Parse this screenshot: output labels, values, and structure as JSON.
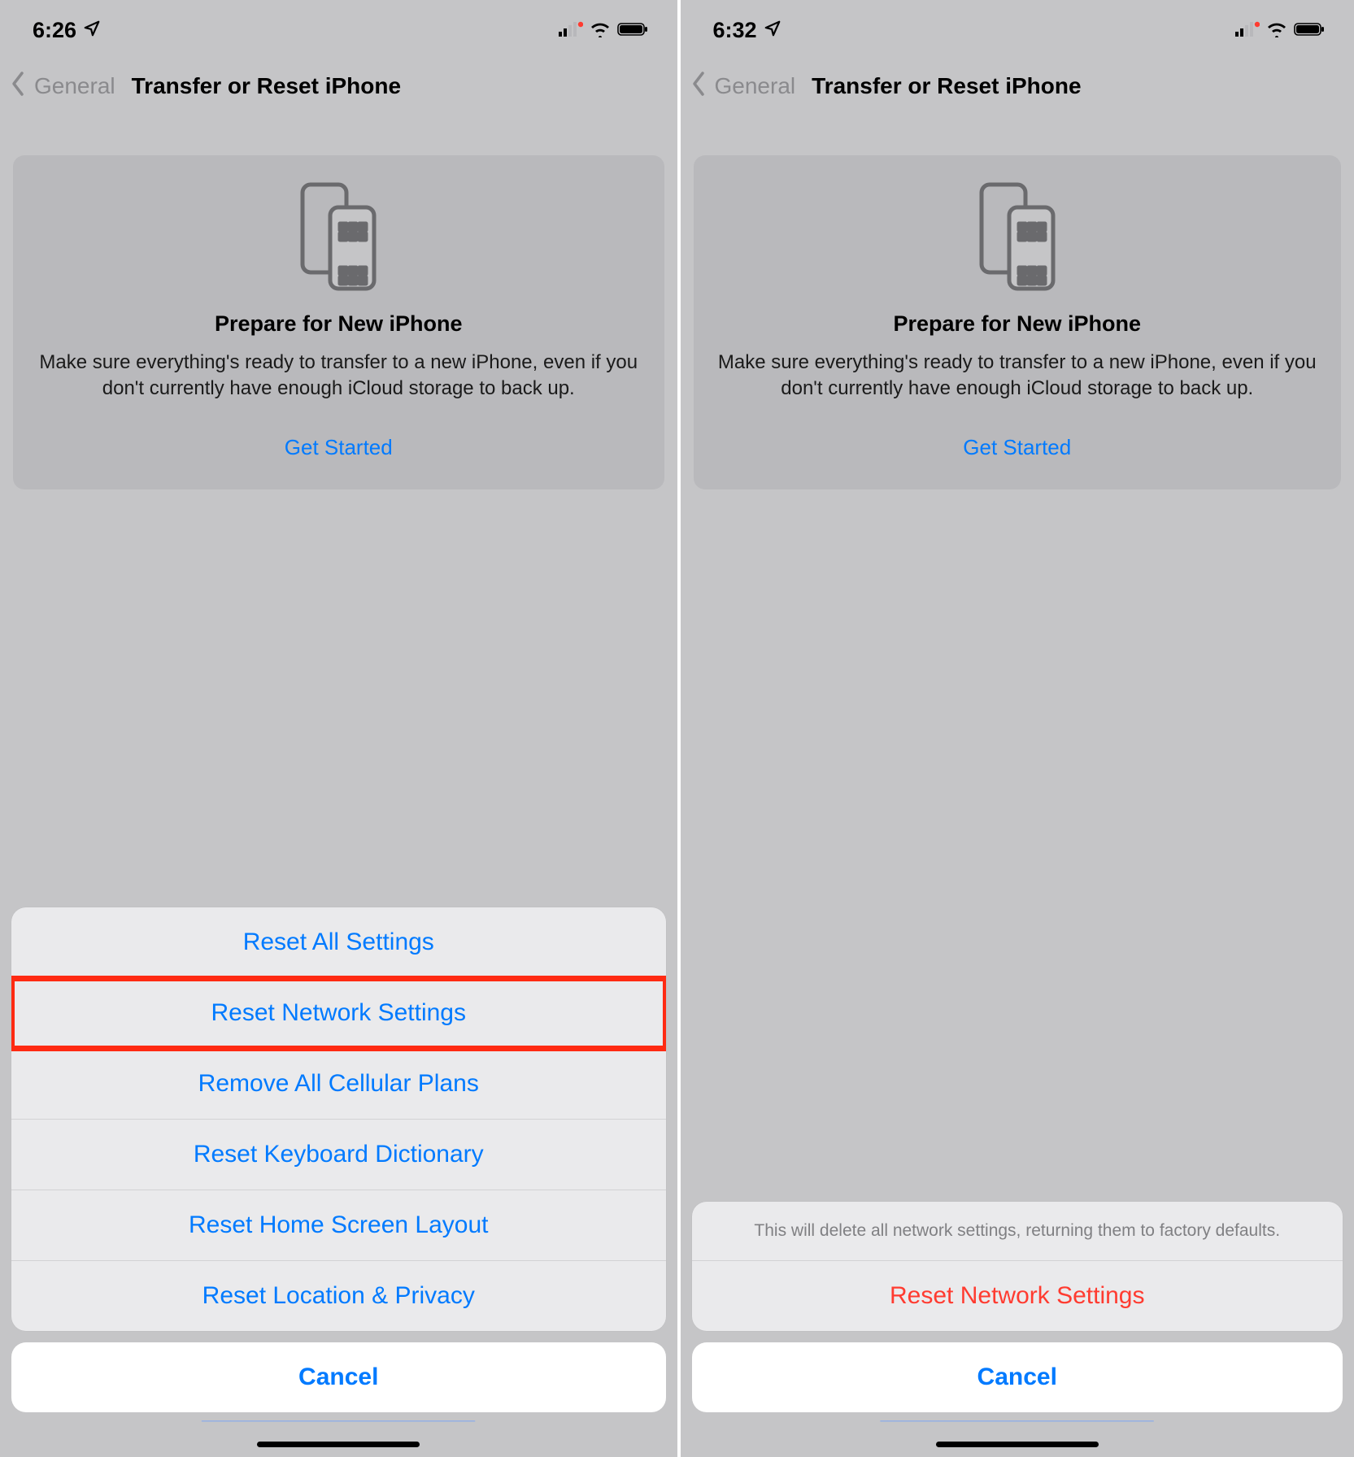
{
  "screens": [
    {
      "status_time": "6:26",
      "back_label": "General",
      "page_title": "Transfer or Reset iPhone",
      "card": {
        "heading": "Prepare for New iPhone",
        "desc": "Make sure everything's ready to transfer to a new iPhone, even if you don't currently have enough iCloud storage to back up.",
        "link": "Get Started"
      },
      "sheet": {
        "items": [
          {
            "label": "Reset All Settings",
            "highlighted": false
          },
          {
            "label": "Reset Network Settings",
            "highlighted": true
          },
          {
            "label": "Remove All Cellular Plans",
            "highlighted": false
          },
          {
            "label": "Reset Keyboard Dictionary",
            "highlighted": false
          },
          {
            "label": "Reset Home Screen Layout",
            "highlighted": false
          },
          {
            "label": "Reset Location & Privacy",
            "highlighted": false
          }
        ]
      },
      "cancel": "Cancel"
    },
    {
      "status_time": "6:32",
      "back_label": "General",
      "page_title": "Transfer or Reset iPhone",
      "card": {
        "heading": "Prepare for New iPhone",
        "desc": "Make sure everything's ready to transfer to a new iPhone, even if you don't currently have enough iCloud storage to back up.",
        "link": "Get Started"
      },
      "confirm": {
        "message": "This will delete all network settings, returning them to factory defaults.",
        "action": "Reset Network Settings"
      },
      "cancel": "Cancel"
    }
  ]
}
